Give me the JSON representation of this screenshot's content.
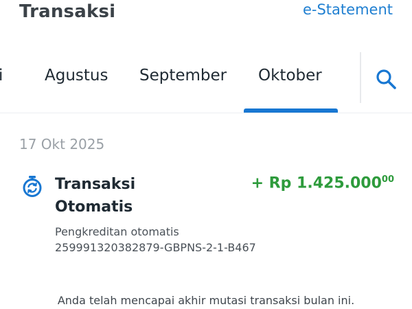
{
  "header": {
    "title": "Transaksi",
    "estatement_label": "e-Statement"
  },
  "tabs": {
    "partial_label": "i",
    "items": [
      {
        "label": "Agustus"
      },
      {
        "label": "September"
      },
      {
        "label": "Oktober",
        "active": true
      }
    ],
    "active_color": "#1877d2"
  },
  "icons": {
    "search": "search-icon",
    "transaction": "auto-transaction-icon"
  },
  "transactions": {
    "date": "17 Okt 2025",
    "items": [
      {
        "title": "Transaksi Otomatis",
        "amount_main": "+ Rp 1.425.000",
        "amount_cents": "00",
        "description": "Pengkreditan otomatis",
        "reference": "259991320382879-GBPNS-2-1-B467",
        "amount_color": "#2e9b3c"
      }
    ]
  },
  "footer_note": "Anda telah mencapai akhir mutasi transaksi bulan ini."
}
